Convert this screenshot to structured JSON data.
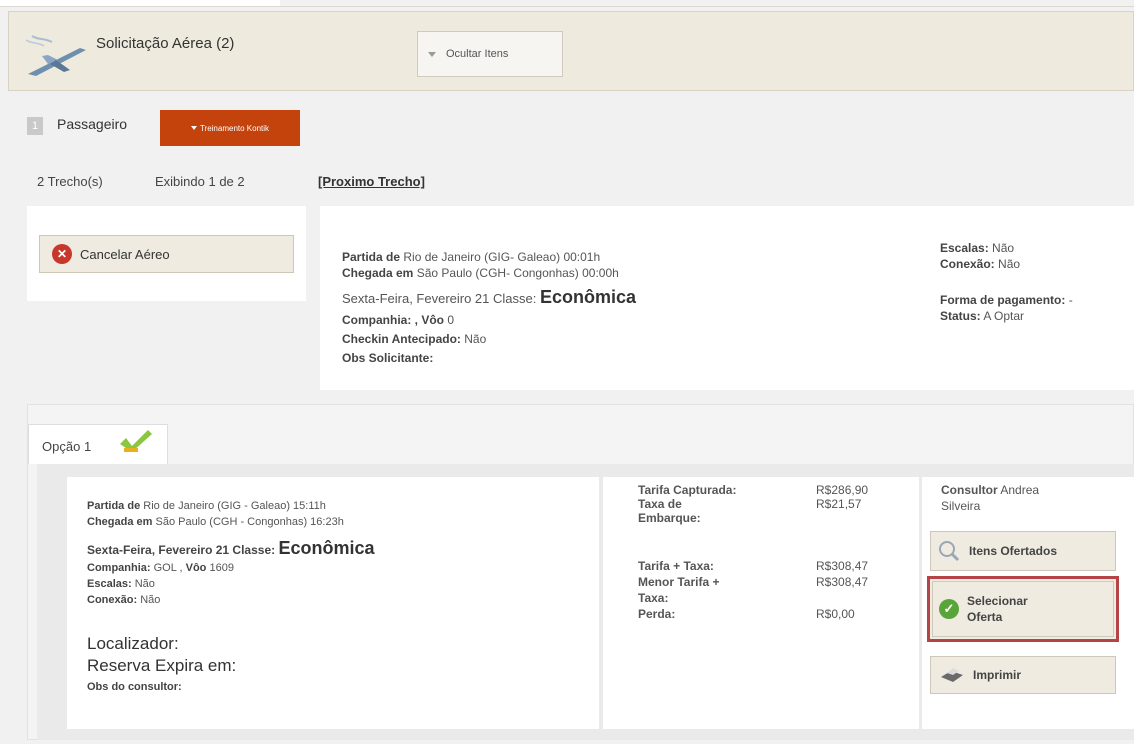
{
  "header": {
    "title": "Solicitação Aérea (2)",
    "hide_button": "Ocultar Itens"
  },
  "passenger": {
    "number": "1",
    "label": "Passageiro",
    "name_badge": "Treinamento Kontik"
  },
  "segments": {
    "count": "2 Trecho(s)",
    "showing": "Exibindo 1 de 2",
    "next_link": "[Proximo Trecho]"
  },
  "cancel": {
    "label": "Cancelar Aéreo"
  },
  "flight": {
    "departure_label": "Partida de",
    "departure_value": "Rio de Janeiro  (GIG- Galeao) 00:01h",
    "arrival_label": "Chegada em",
    "arrival_value": "São Paulo (CGH- Congonhas) 00:00h",
    "date": "Sexta-Feira, Fevereiro 21",
    "class_label": "Classe:",
    "class_value": "Econômica",
    "company_label": "Companhia: , Vôo",
    "company_value": "0",
    "checkin_label": "Checkin Antecipado:",
    "checkin_value": "Não",
    "obs_label": "Obs Solicitante:",
    "stops_label": "Escalas:",
    "stops_value": "Não",
    "connection_label": "Conexão:",
    "connection_value": "Não",
    "payment_label": "Forma de pagamento:",
    "payment_value": "-",
    "status_label": "Status:",
    "status_value": "A Optar"
  },
  "option": {
    "tab_label": "Opção",
    "tab_number": "1",
    "departure_label": "Partida de",
    "departure_value": "Rio de Janeiro (GIG  - Galeao) 15:11h",
    "arrival_label": "Chegada em",
    "arrival_value": "São Paulo (CGH  - Congonhas) 16:23h",
    "date": "Sexta-Feira, Fevereiro 21",
    "class_label": "Classe:",
    "class_value": "Econômica",
    "company_label": "Companhia:",
    "company_value": "GOL ,",
    "flight_label": "Vôo",
    "flight_value": "1609",
    "stops_label": "Escalas:",
    "stops_value": "Não",
    "connection_label": "Conexão:",
    "connection_value": "Não",
    "locator_label": "Localizador:",
    "expires_label": "Reserva Expira em:",
    "obs_label": "Obs do consultor:",
    "prices": [
      {
        "label": "Tarifa Capturada:",
        "value": "R$286,90"
      },
      {
        "label": "Taxa de",
        "label2": "Embarque:",
        "value": "R$21,57"
      },
      {
        "label": "Tarifa + Taxa:",
        "value": "R$308,47"
      },
      {
        "label": "Menor Tarifa +",
        "label2": "Taxa:",
        "value": "R$308,47"
      },
      {
        "label": "Perda:",
        "value": "R$0,00"
      }
    ],
    "consultant_label": "Consultor",
    "consultant_first": "Andrea",
    "consultant_last": "Silveira",
    "offered_button": "Itens Ofertados",
    "select_button_line1": "Selecionar",
    "select_button_line2": "Oferta",
    "print_button": "Imprimir"
  },
  "colors": {
    "badge": "#c4420c",
    "highlight": "#b54446",
    "header_bg": "#eeeade"
  }
}
